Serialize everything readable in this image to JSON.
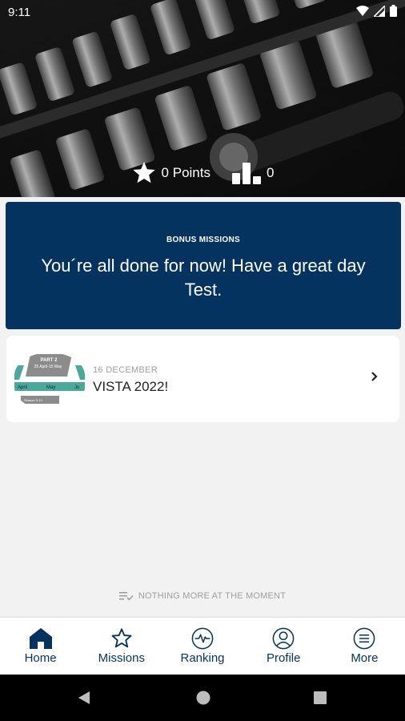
{
  "status_bar": {
    "time": "9:11"
  },
  "stats": {
    "points": "0 Points",
    "rank": "0"
  },
  "banner": {
    "kicker": "BONUS MISSIONS",
    "message": "You´re all done for now! Have a great day Test."
  },
  "mission_card": {
    "date": "16 DECEMBER",
    "title": "VISTA 2022!",
    "thumb_part": "PART 2",
    "thumb_dates": "25 April-15 May",
    "thumb_months": [
      "April",
      "May",
      "Ju"
    ],
    "thumb_footer": "Season 9-12"
  },
  "footer_note": "NOTHING MORE AT THE MOMENT",
  "tabs": [
    {
      "label": "Home",
      "icon": "home-icon"
    },
    {
      "label": "Missions",
      "icon": "star-outline-icon"
    },
    {
      "label": "Ranking",
      "icon": "activity-icon"
    },
    {
      "label": "Profile",
      "icon": "user-circle-icon"
    },
    {
      "label": "More",
      "icon": "menu-circle-icon"
    }
  ],
  "colors": {
    "brand": "#04335f",
    "background": "#f2f2f2",
    "thumb_teal": "#4aa998"
  }
}
